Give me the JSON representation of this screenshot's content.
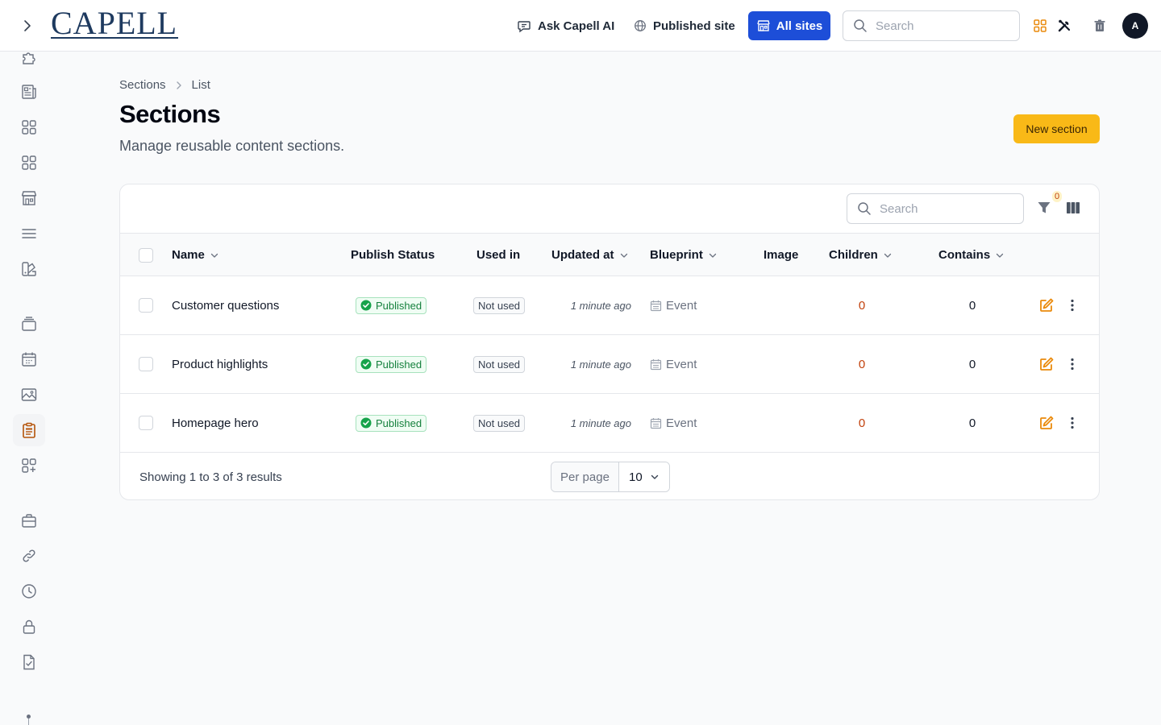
{
  "topbar": {
    "ask_ai": "Ask Capell AI",
    "published_site": "Published site",
    "all_sites": "All sites",
    "search_placeholder": "Search",
    "avatar_initial": "A",
    "logo_text": "CAPELL"
  },
  "header": {
    "breadcrumb": [
      "Sections",
      "List"
    ],
    "title": "Sections",
    "subtitle": "Manage reusable content sections.",
    "new_button": "New section"
  },
  "table": {
    "search_placeholder": "Search",
    "filter_count": "0",
    "columns": {
      "name": "Name",
      "publish_status": "Publish Status",
      "used_in": "Used in",
      "updated_at": "Updated at",
      "blueprint": "Blueprint",
      "image": "Image",
      "children": "Children",
      "contains": "Contains"
    },
    "rows": [
      {
        "name": "Customer questions",
        "status": "Published",
        "used_in": "Not used",
        "updated": "1 minute ago",
        "blueprint": "Event",
        "children": "0",
        "contains": "0"
      },
      {
        "name": "Product highlights",
        "status": "Published",
        "used_in": "Not used",
        "updated": "1 minute ago",
        "blueprint": "Event",
        "children": "0",
        "contains": "0"
      },
      {
        "name": "Homepage hero",
        "status": "Published",
        "used_in": "Not used",
        "updated": "1 minute ago",
        "blueprint": "Event",
        "children": "0",
        "contains": "0"
      }
    ],
    "footer": {
      "showing": "Showing 1 to 3 of 3 results",
      "per_page_label": "Per page",
      "per_page_value": "10"
    }
  },
  "sidebar_icons": [
    "puzzle-icon",
    "newspaper-icon",
    "grid-icon",
    "grid-icon",
    "storefront-icon",
    "menu-lines-icon",
    "swatch-icon",
    "stack-icon",
    "calendar-icon",
    "image-icon",
    "clipboard-icon",
    "grid-plus-icon",
    "briefcase-icon",
    "link-icon",
    "clock-icon",
    "lock-icon",
    "document-check-icon"
  ],
  "colors": {
    "primary": "#1d4ed8",
    "accent": "#f9b917",
    "success": "#15803d",
    "warning": "#c2410c"
  }
}
